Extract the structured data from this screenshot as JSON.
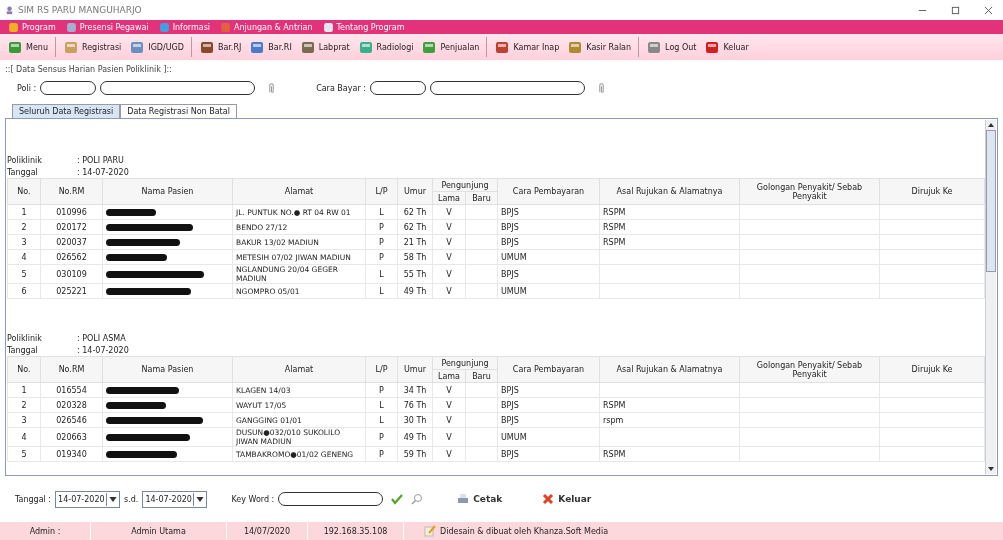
{
  "window": {
    "title": "SIM RS PARU MANGUHARJO"
  },
  "menu_bar": [
    "Program",
    "Presensi Pegawai",
    "Informasi",
    "Anjungan & Antrian",
    "Tentang Program"
  ],
  "toolbar": [
    {
      "label": "Menu",
      "kind": "home"
    },
    {
      "kind": "separator"
    },
    {
      "label": "Registrasi",
      "kind": "form"
    },
    {
      "label": "IGD/UGD",
      "kind": "person"
    },
    {
      "kind": "separator"
    },
    {
      "label": "Bar.RJ",
      "kind": "book"
    },
    {
      "label": "Bar.RI",
      "kind": "stack"
    },
    {
      "label": "Labprat",
      "kind": "frame"
    },
    {
      "label": "Radiologi",
      "kind": "doctor"
    },
    {
      "label": "Penjualan",
      "kind": "cart"
    },
    {
      "kind": "separator"
    },
    {
      "label": "Kamar Inap",
      "kind": "house"
    },
    {
      "label": "Kasir Ralan",
      "kind": "ledger"
    },
    {
      "kind": "separator"
    },
    {
      "label": "Log Out",
      "kind": "key"
    },
    {
      "label": "Keluar",
      "kind": "cross"
    }
  ],
  "panel_title": "::[ Data Sensus Harian Pasien Poliklinik ]::",
  "filters": [
    {
      "label": "Poli :"
    },
    {
      "label": "Cara Bayar :"
    }
  ],
  "tabs": [
    {
      "label": "Seluruh Data Registrasi",
      "selected": true
    },
    {
      "label": "Data Registrasi Non Batal",
      "selected": false
    }
  ],
  "sections": [
    {
      "poliklinik_label": "Poliklinik",
      "poliklinik": ": POLI PARU",
      "tanggal_label": "Tanggal",
      "tanggal": ": 14-07-2020",
      "columns": [
        "No.",
        "No.RM",
        "Nama Pasien",
        "Alamat",
        "L/P",
        "Umur",
        "Pengunjung",
        "Cara Pembayaran",
        "Asal Rujukan & Alamatnya",
        "Golongan Penyakit/ Sebab Penyakit",
        "Dirujuk Ke"
      ],
      "subcolumns": [
        "Lama",
        "Baru"
      ],
      "rows": [
        {
          "no": "1",
          "rm": "010996",
          "alamat": "JL. PUNTUK NO.● RT 04 RW 01",
          "lp": "L",
          "umur": "62 Th",
          "lama": "V",
          "bayar": "BPJS",
          "asal": "RSPM"
        },
        {
          "no": "2",
          "rm": "020172",
          "alamat": "BENDO 27/12",
          "lp": "P",
          "umur": "62 Th",
          "lama": "V",
          "bayar": "BPJS",
          "asal": "RSPM"
        },
        {
          "no": "3",
          "rm": "020037",
          "alamat": "BAKUR 13/02 MADIUN",
          "lp": "P",
          "umur": "21 Th",
          "lama": "V",
          "bayar": "BPJS",
          "asal": "RSPM"
        },
        {
          "no": "4",
          "rm": "026562",
          "alamat": "METESIH 07/02 JIWAN MADIUN",
          "lp": "P",
          "umur": "58 Th",
          "lama": "V",
          "bayar": "UMUM"
        },
        {
          "no": "5",
          "rm": "030109",
          "alamat": "NGLANDUNG 20/04 GEGER MADIUN",
          "lp": "L",
          "umur": "55 Th",
          "lama": "V",
          "bayar": "BPJS"
        },
        {
          "no": "6",
          "rm": "025221",
          "alamat": "NGOMPRO 05/01",
          "lp": "L",
          "umur": "49 Th",
          "lama": "V",
          "bayar": "UMUM"
        }
      ]
    },
    {
      "poliklinik_label": "Poliklinik",
      "poliklinik": ": POLI ASMA",
      "tanggal_label": "Tanggal",
      "tanggal": ": 14-07-2020",
      "columns": [
        "No.",
        "No.RM",
        "Nama Pasien",
        "Alamat",
        "L/P",
        "Umur",
        "Pengunjung",
        "Cara Pembayaran",
        "Asal Rujukan & Alamatnya",
        "Golongan Penyakit/ Sebab Penyakit",
        "Dirujuk Ke"
      ],
      "subcolumns": [
        "Lama",
        "Baru"
      ],
      "rows": [
        {
          "no": "1",
          "rm": "016554",
          "alamat": "KLAGEN 14/03",
          "lp": "P",
          "umur": "34 Th",
          "lama": "V",
          "bayar": "BPJS"
        },
        {
          "no": "2",
          "rm": "020328",
          "alamat": "WAYUT 17/05",
          "lp": "L",
          "umur": "76 Th",
          "lama": "V",
          "bayar": "BPJS",
          "asal": "RSPM"
        },
        {
          "no": "3",
          "rm": "026546",
          "alamat": "GANGGING 01/01",
          "lp": "L",
          "umur": "30 Th",
          "lama": "V",
          "bayar": "BPJS",
          "asal": "rspm"
        },
        {
          "no": "4",
          "rm": "020663",
          "alamat": "DUSUN●032/010 SUKOLILO JIWAN MADIUN",
          "lp": "P",
          "umur": "49 Th",
          "lama": "V",
          "bayar": "UMUM"
        },
        {
          "no": "5",
          "rm": "019340",
          "alamat": "TAMBAKROMO●01/02 GENENG",
          "lp": "P",
          "umur": "59 Th",
          "lama": "V",
          "bayar": "BPJS",
          "asal": "RSPM"
        }
      ]
    }
  ],
  "bottom": {
    "tanggal_label": "Tanggal :",
    "date_from": "14-07-2020",
    "sd_label": "s.d.",
    "date_to": "14-07-2020",
    "keyword_label": "Key Word :",
    "print": "Cetak",
    "exit": "Keluar"
  },
  "status_bar": [
    "Admin :",
    "Admin Utama",
    "14/07/2020",
    "192.168.35.108",
    "Didesain & dibuat oleh Khanza.Soft Media"
  ]
}
